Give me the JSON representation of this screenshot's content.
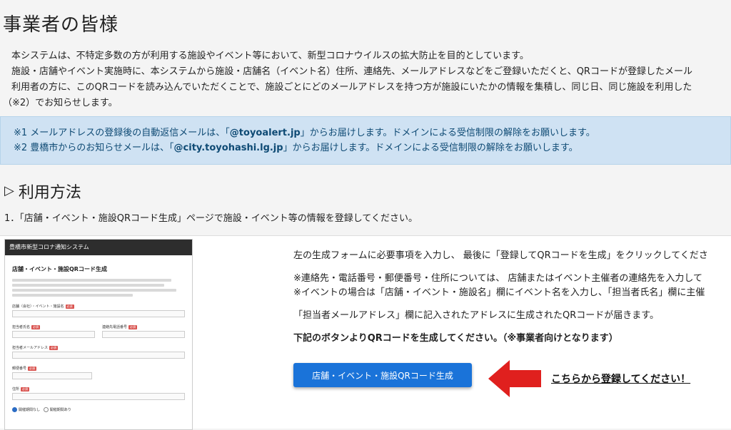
{
  "page": {
    "title": "事業者の皆様",
    "intro": [
      "本システムは、不特定多数の方が利用する施設やイベント等において、新型コロナウイルスの拡大防止を目的としています。",
      "施設・店舗やイベント実施時に、本システムから施設・店舗名（イベント名）住所、連絡先、メールアドレスなどをご登録いただくと、QRコードが登録したメール",
      "利用者の方に、このQRコードを読み込んでいただくことで、施設ごとにどのメールアドレスを持つ方が施設にいたかの情報を集積し、同じ日、同じ施設を利用した",
      "（※2）でお知らせします。"
    ]
  },
  "notice": {
    "line1_prefix": "※1 メールアドレスの登録後の自動返信メールは、「",
    "line1_email": "@toyoalert.jp",
    "line1_suffix": "」からお届けします。ドメインによる受信制限の解除をお願いします。",
    "line2_prefix": "※2 豊橋市からのお知らせメールは、「",
    "line2_email": "@city.toyohashi.lg.jp",
    "line2_suffix": "」からお届けします。ドメインによる受信制限の解除をお願いします。"
  },
  "usage": {
    "heading_icon": "triangle-right-icon",
    "heading": "利用方法",
    "step1": "1．「店舗・イベント・施設QRコード生成」ページで施設・イベント等の情報を登録してください。"
  },
  "thumbnail": {
    "header": "豊橋市新型コロナ通知システム",
    "form_title": "店舗・イベント・施設QRコード生成",
    "required_badge": "必須",
    "fields": {
      "name": "店舗（会社）・イベント・施設名",
      "person": "担当者氏名",
      "phone": "連絡先電話番号",
      "email": "担当者メールアドレス",
      "zip": "郵便番号",
      "address": "住所"
    },
    "radio1": "開催期間なし",
    "radio2": "開催期間あり"
  },
  "instructions": {
    "line1": "左の生成フォームに必要事項を入力し、 最後に「登録してQRコードを生成」をクリックしてくださ",
    "line2": "※連絡先・電話番号・郵便番号・住所については、 店舗またはイベント主催者の連絡先を入力して",
    "line3": "※イベントの場合は「店舗・イベント・施設名」欄にイベント名を入力し、「担当者氏名」欄に主催",
    "line4": "「担当者メールアドレス」欄に記入されたアドレスに生成されたQRコードが届きます。",
    "line5": "下記のボタンよりQRコードを生成してください。（※事業者向けとなります）",
    "button": "店舗・イベント・施設QRコード生成",
    "arrow_label": "こちらから登録してください！",
    "arrow_icon": "red-arrow-left-icon",
    "arrow_color": "#e0201e",
    "button_color": "#1a73d9"
  }
}
